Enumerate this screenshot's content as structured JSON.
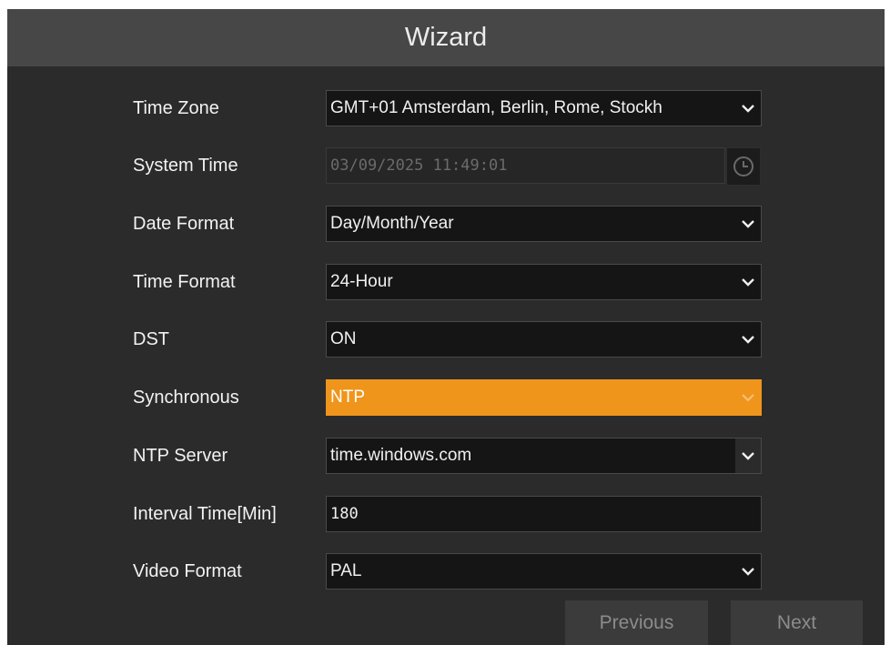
{
  "window": {
    "title": "Wizard"
  },
  "rows": {
    "time_zone": {
      "label": "Time Zone",
      "value": "GMT+01 Amsterdam, Berlin, Rome, Stockh"
    },
    "system_time": {
      "label": "System Time",
      "value": "03/09/2025 11:49:01"
    },
    "date_format": {
      "label": "Date Format",
      "value": "Day/Month/Year"
    },
    "time_format": {
      "label": "Time Format",
      "value": "24-Hour"
    },
    "dst": {
      "label": "DST",
      "value": "ON"
    },
    "synchronous": {
      "label": "Synchronous",
      "value": "NTP"
    },
    "ntp_server": {
      "label": "NTP Server",
      "value": "time.windows.com"
    },
    "interval_time": {
      "label": "Interval Time[Min]",
      "value": "180"
    },
    "video_format": {
      "label": "Video Format",
      "value": "PAL"
    }
  },
  "buttons": {
    "previous": "Previous",
    "next": "Next"
  },
  "colors": {
    "accent": "#ef951b",
    "panel": "#2b2b2b",
    "titlebar": "#474747"
  },
  "icons": {
    "dropdown": "chevron-down-icon",
    "clock": "clock-icon"
  }
}
